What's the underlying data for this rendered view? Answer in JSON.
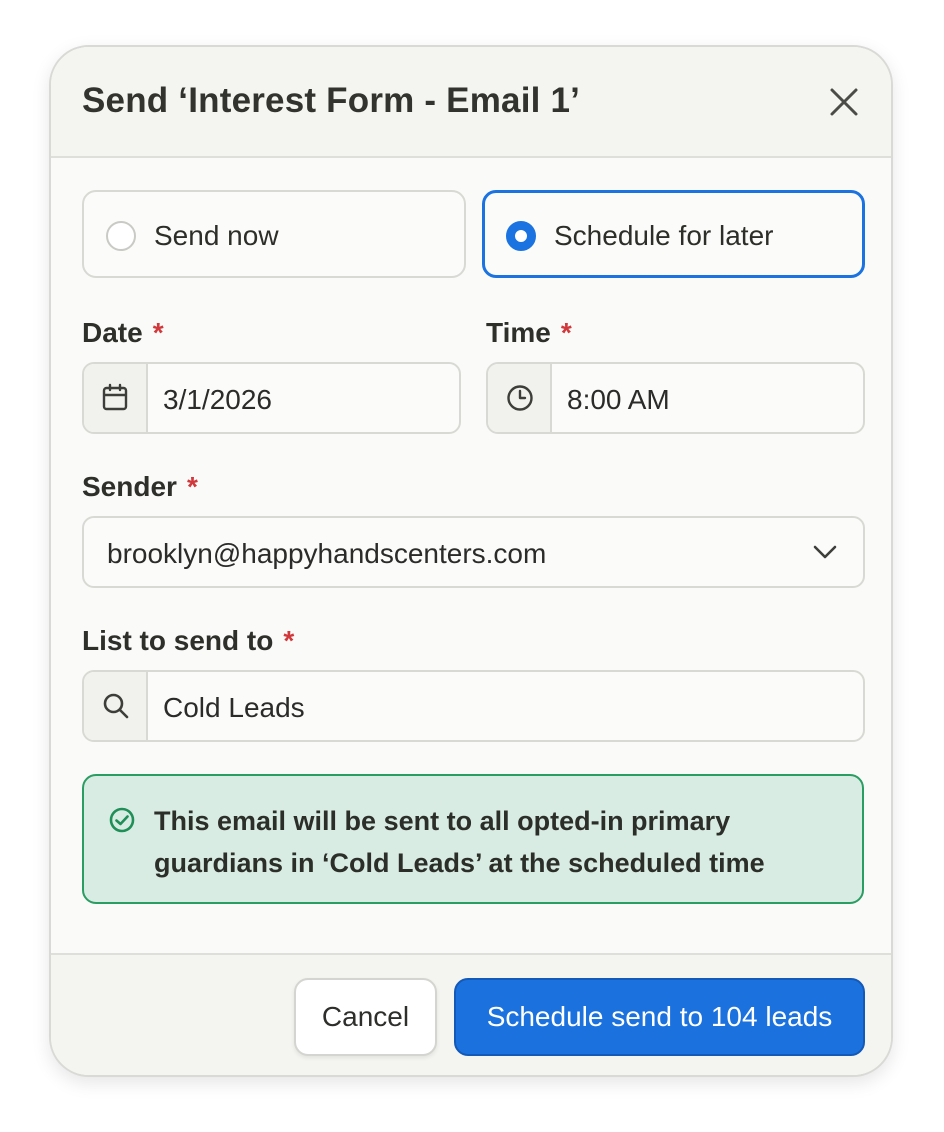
{
  "dialog": {
    "title": "Send ‘Interest Form - Email 1’",
    "close_icon": "close-icon"
  },
  "send_mode": {
    "options": [
      {
        "label": "Send now",
        "selected": false
      },
      {
        "label": "Schedule for later",
        "selected": true
      }
    ]
  },
  "date": {
    "label": "Date",
    "required_mark": "*",
    "value": "3/1/2026",
    "icon": "calendar-icon"
  },
  "time": {
    "label": "Time",
    "required_mark": "*",
    "value": "8:00 AM",
    "icon": "clock-icon"
  },
  "sender": {
    "label": "Sender",
    "required_mark": "*",
    "value": "brooklyn@happyhandscenters.com",
    "icon": "chevron-down-icon"
  },
  "list": {
    "label": "List to send to",
    "required_mark": "*",
    "value": "Cold Leads",
    "icon": "search-icon"
  },
  "notice": {
    "text": "This email will be sent to all opted-in primary guardians in ‘Cold Leads’ at the scheduled time",
    "icon": "check-circle-icon"
  },
  "footer": {
    "cancel_label": "Cancel",
    "primary_label": "Schedule send to 104 leads"
  },
  "colors": {
    "accent": "#1a73e0",
    "required": "#d0383b",
    "success_border": "#2a9d62",
    "success_bg": "#d9ece3"
  }
}
